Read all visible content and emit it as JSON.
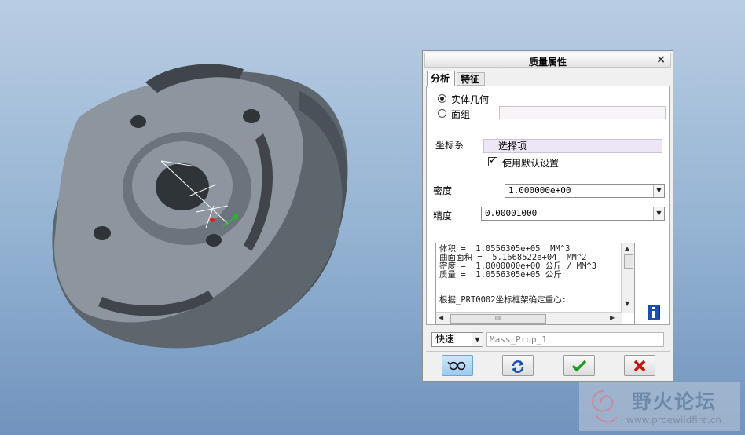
{
  "dialog": {
    "title": "质量属性",
    "close_label": "×",
    "tabs": [
      {
        "label": "分析",
        "active": true
      },
      {
        "label": "特征",
        "active": false
      }
    ],
    "analysis": {
      "radio_solid": {
        "label": "实体几何",
        "checked": true
      },
      "radio_quilt": {
        "label": "面组",
        "checked": false
      },
      "quilt_value": "",
      "csys_label": "坐标系",
      "csys_value": "选择项",
      "use_default_label": "使用默认设置",
      "use_default_checked": true,
      "density_label": "密度",
      "density_value": "1.000000e+00",
      "accuracy_label": "精度",
      "accuracy_value": "0.00001000",
      "results": [
        "体积 =  1.0556305e+05  MM^3",
        "曲面面积 =  5.1668522e+04  MM^2",
        "密度 =  1.0000000e+00 公斤 / MM^3",
        "质量 =  1.0556305e+05 公斤"
      ],
      "results_note": "根据_PRT0002坐标框架确定重心:",
      "hscroll_thumb": "IIII"
    },
    "quick_value": "快速",
    "name_value": "Mass_Prop_1",
    "buttons": {
      "preview": "glasses-icon",
      "repeat": "refresh-icon",
      "ok": "check-icon",
      "cancel": "cancel-x-icon"
    }
  },
  "watermark": {
    "text": "野火论坛",
    "url": "www.proewildfire.cn"
  },
  "colors": {
    "accent_green": "#1e9a1e",
    "cancel_red": "#cc1111",
    "info_blue": "#1b4fb3",
    "model_gray": "#8b939c"
  }
}
